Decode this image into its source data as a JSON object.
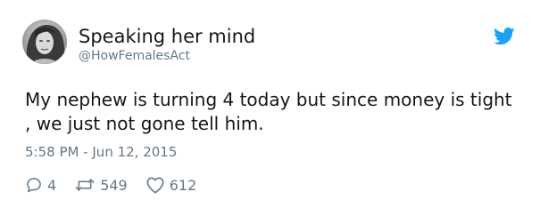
{
  "user": {
    "display_name": "Speaking her mind",
    "handle": "@HowFemalesAct"
  },
  "tweet": {
    "text": "My nephew is turning 4 today but since money is tight , we just not gone tell him.",
    "timestamp": "5:58 PM - Jun 12, 2015"
  },
  "actions": {
    "replies": "4",
    "retweets": "549",
    "likes": "612"
  },
  "icons": {
    "brand": "twitter-bird-icon",
    "reply": "reply-icon",
    "retweet": "retweet-icon",
    "like": "heart-icon"
  },
  "colors": {
    "text_primary": "#14171a",
    "text_secondary": "#657786",
    "twitter_blue": "#1da1f2"
  }
}
